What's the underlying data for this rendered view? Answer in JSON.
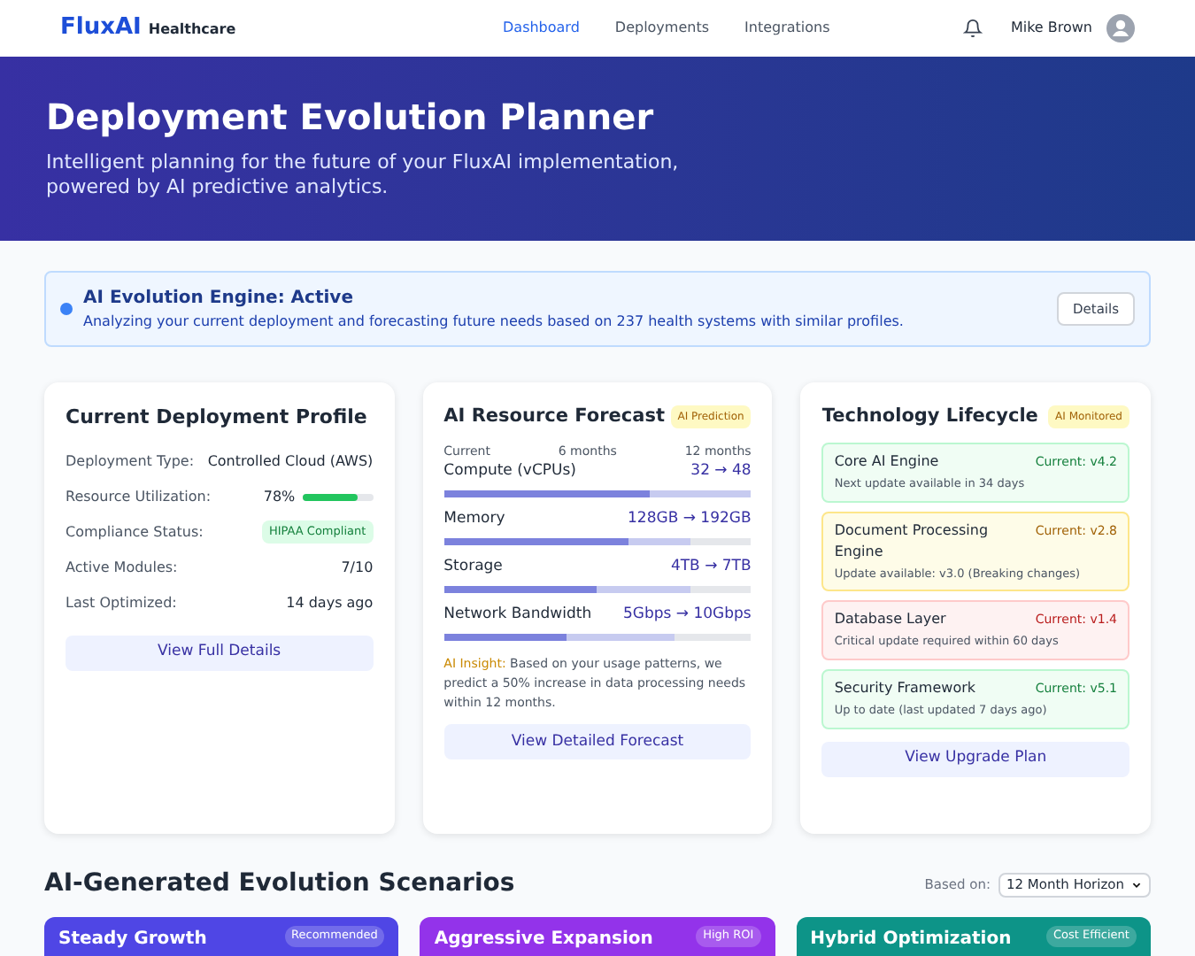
{
  "header": {
    "brand": "FluxAI",
    "brand_suffix": "Healthcare",
    "nav": [
      {
        "label": "Dashboard",
        "selected": true
      },
      {
        "label": "Deployments",
        "selected": false
      },
      {
        "label": "Integrations",
        "selected": false
      }
    ],
    "user": "Mike Brown"
  },
  "hero": {
    "title": "Deployment Evolution Planner",
    "subtitle": "Intelligent planning for the future of your FluxAI implementation, powered by AI predictive analytics."
  },
  "engine": {
    "active": true,
    "title": "AI Evolution Engine: Active",
    "text": "Analyzing your current deployment and forecasting future needs based on 237 health systems with similar profiles.",
    "button": "Details"
  },
  "profile": {
    "title": "Current Deployment Profile",
    "rows": [
      {
        "kind": "text",
        "label": "Deployment Type:",
        "value": "Controlled Cloud (AWS)"
      },
      {
        "kind": "meter",
        "label": "Resource Utilization:",
        "value": "78%",
        "level": 0.78
      },
      {
        "kind": "badge",
        "label": "Compliance Status:",
        "value": "HIPAA Compliant"
      },
      {
        "kind": "text",
        "label": "Active Modules:",
        "value": "7/10"
      },
      {
        "kind": "text",
        "label": "Last Optimized:",
        "value": "14 days ago"
      }
    ],
    "button": "View Full Details"
  },
  "forecast": {
    "title": "AI Resource Forecast",
    "badge": "AI Prediction",
    "axis": [
      "Current",
      "6 months",
      "12 months"
    ],
    "resources": [
      {
        "name": "Compute (vCPUs)",
        "reading": "32 → 48",
        "current": {
          "level": 0.67
        },
        "projected": {
          "level": 1
        }
      },
      {
        "name": "Memory",
        "reading": "128GB → 192GB",
        "current": {
          "level": 0.6
        },
        "projected": {
          "level": 0.8
        }
      },
      {
        "name": "Storage",
        "reading": "4TB → 7TB",
        "current": {
          "level": 0.5
        },
        "projected": {
          "level": 0.8
        }
      },
      {
        "name": "Network Bandwidth",
        "reading": "5Gbps → 10Gbps",
        "current": {
          "level": 0.4
        },
        "projected": {
          "level": 0.75
        }
      }
    ],
    "insight_label": "AI Insight:",
    "insight": "Based on your usage patterns, we predict a 50% increase in data processing needs within 12 months.",
    "button": "View Detailed Forecast"
  },
  "lifecycle": {
    "title": "Technology Lifecycle",
    "badge": "AI Monitored",
    "items": [
      {
        "name": "Core AI Engine",
        "version": "Current: v4.2",
        "note": "Next update available in 34 days",
        "kind": "ok"
      },
      {
        "name": "Document Processing Engine",
        "version": "Current: v2.8",
        "note": "Update available: v3.0 (Breaking changes)",
        "kind": "warning"
      },
      {
        "name": "Database Layer",
        "version": "Current: v1.4",
        "note": "Critical update required within 60 days",
        "kind": "critical"
      },
      {
        "name": "Security Framework",
        "version": "Current: v5.1",
        "note": "Up to date (last updated 7 days ago)",
        "kind": "ok"
      }
    ],
    "button": "View Upgrade Plan"
  },
  "scenarios": {
    "title": "AI-Generated Evolution Scenarios",
    "based_on_label": "Based on:",
    "horizon": "12 Month Horizon",
    "items": [
      {
        "name": "Steady Growth",
        "badge": "Recommended",
        "color": "#4f46e5"
      },
      {
        "name": "Aggressive Expansion",
        "badge": "High ROI",
        "color": "#9333ea"
      },
      {
        "name": "Hybrid Optimization",
        "badge": "Cost Efficient",
        "color": "#0d9488"
      }
    ]
  }
}
